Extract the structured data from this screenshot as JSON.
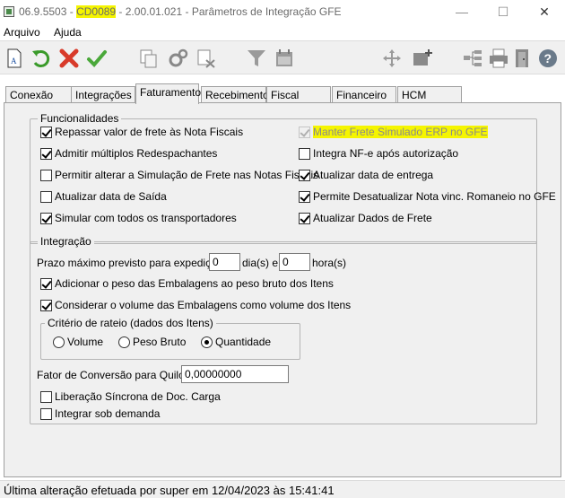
{
  "window": {
    "title_prefix": "06.9.5503 - ",
    "title_highlight": "CD0089",
    "title_suffix": " - 2.00.01.021 - Parâmetros de Integração GFE",
    "minimize": "—",
    "maximize": "☐",
    "close": "✕"
  },
  "menu": {
    "items": [
      "Arquivo",
      "Ajuda"
    ]
  },
  "toolbar": {
    "icons": [
      "document-icon",
      "undo-icon",
      "cancel-icon",
      "confirm-icon",
      "copy-icon",
      "gears-icon",
      "settings-doc-icon",
      "filter-icon",
      "calendar-icon",
      "move-icon",
      "folder-add-icon",
      "tree-icon",
      "print-icon",
      "exit-icon",
      "help-icon"
    ]
  },
  "tabs": [
    "Conexão",
    "Integrações",
    "Faturamento",
    "Recebimento",
    "Fiscal",
    "Financeiro",
    "HCM"
  ],
  "active_tab": "Faturamento",
  "funcionalidades": {
    "legend": "Funcionalidades",
    "left": [
      {
        "label": "Repassar valor de frete às Nota Fiscais",
        "checked": true
      },
      {
        "label": "Admitir múltiplos Redespachantes",
        "checked": true
      },
      {
        "label": "Permitir alterar a Simulação de Frete nas Notas Fiscais",
        "checked": false
      },
      {
        "label": "Atualizar data de Saída",
        "checked": false
      },
      {
        "label": "Simular com todos os transportadores",
        "checked": true
      }
    ],
    "right": [
      {
        "label": "Manter Frete Simulado ERP no GFE",
        "checked": true,
        "disabled": true
      },
      {
        "label": "Integra NF-e após autorização",
        "checked": false
      },
      {
        "label": "Atualizar data de entrega",
        "checked": true
      },
      {
        "label": "Permite Desatualizar Nota vinc. Romaneio no GFE",
        "checked": true
      },
      {
        "label": "Atualizar Dados de Frete",
        "checked": true
      }
    ]
  },
  "integracao": {
    "legend": "Integração",
    "prazo_label": "Prazo máximo previsto para expedição:",
    "dias_value": "0",
    "dias_suffix": "dia(s) e",
    "horas_value": "0",
    "horas_suffix": "hora(s)",
    "adicionar_peso": {
      "label": "Adicionar o peso das Embalagens ao peso bruto dos Itens",
      "checked": true
    },
    "considerar_volume": {
      "label": "Considerar o volume das Embalagens como volume dos Itens",
      "checked": true
    },
    "criterio": {
      "legend": "Critério de rateio (dados dos Itens)",
      "options": [
        {
          "label": "Volume",
          "selected": false
        },
        {
          "label": "Peso Bruto",
          "selected": false
        },
        {
          "label": "Quantidade",
          "selected": true
        }
      ]
    },
    "fator_label": "Fator de Conversão para Quilos:",
    "fator_value": "0,00000000",
    "liberacao": {
      "label": "Liberação Síncrona de Doc. Carga",
      "checked": false
    },
    "sob_demanda": {
      "label": "Integrar sob demanda",
      "checked": false
    }
  },
  "status": {
    "text": "Última alteração efetuada por super em 12/04/2023 às 15:41:41"
  }
}
